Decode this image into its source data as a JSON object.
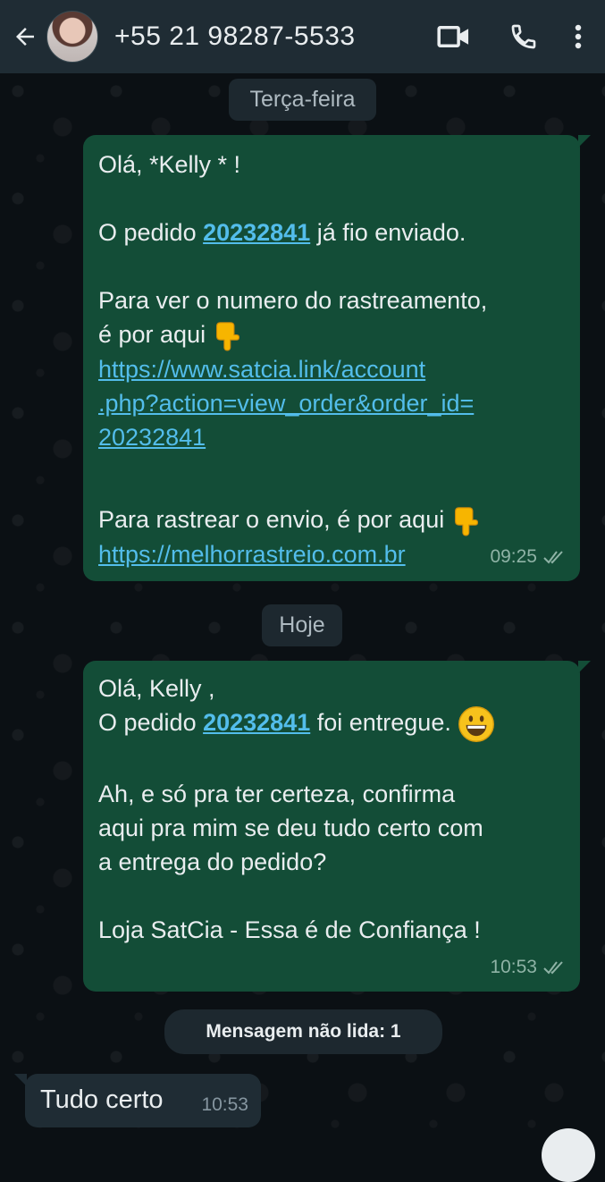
{
  "header": {
    "contact_name": "+55 21 98287-5533",
    "icons": [
      "back-arrow-icon",
      "video-call-icon",
      "phone-icon",
      "more-vert-icon"
    ]
  },
  "chips": {
    "tuesday": "Terça-feira",
    "today": "Hoje"
  },
  "message1": {
    "lines": [
      "Olá, *Kelly * !",
      "O pedido ",
      "20232841",
      " já fio enviado.",
      "Para ver o numero do rastreamento,",
      "é por aqui ",
      "https://www.satcia.link/account",
      ".php?action=view_order&order_id=",
      "20232841",
      "Para rastrear o envio, é por aqui ",
      "https://melhorrastreio.com.br"
    ],
    "time": "09:25"
  },
  "message2": {
    "lines": [
      "Olá, Kelly ,",
      "O pedido ",
      "20232841",
      " foi entregue.",
      "Ah, e só pra ter certeza, confirma",
      "aqui pra mim se deu tudo certo com",
      "a entrega do pedido?",
      "Loja SatCia - Essa é de Confiança !"
    ],
    "time": "10:53"
  },
  "unread_banner": "Mensagem não lida: 1",
  "message3": {
    "text": "Tudo certo",
    "time": "10:53"
  },
  "colors": {
    "header_bg": "#1f2c34",
    "outgoing_bubble": "#134d37",
    "incoming_bubble": "#1f2c34",
    "link": "#53bdeb",
    "read_ticks": "#8fb3a6"
  }
}
